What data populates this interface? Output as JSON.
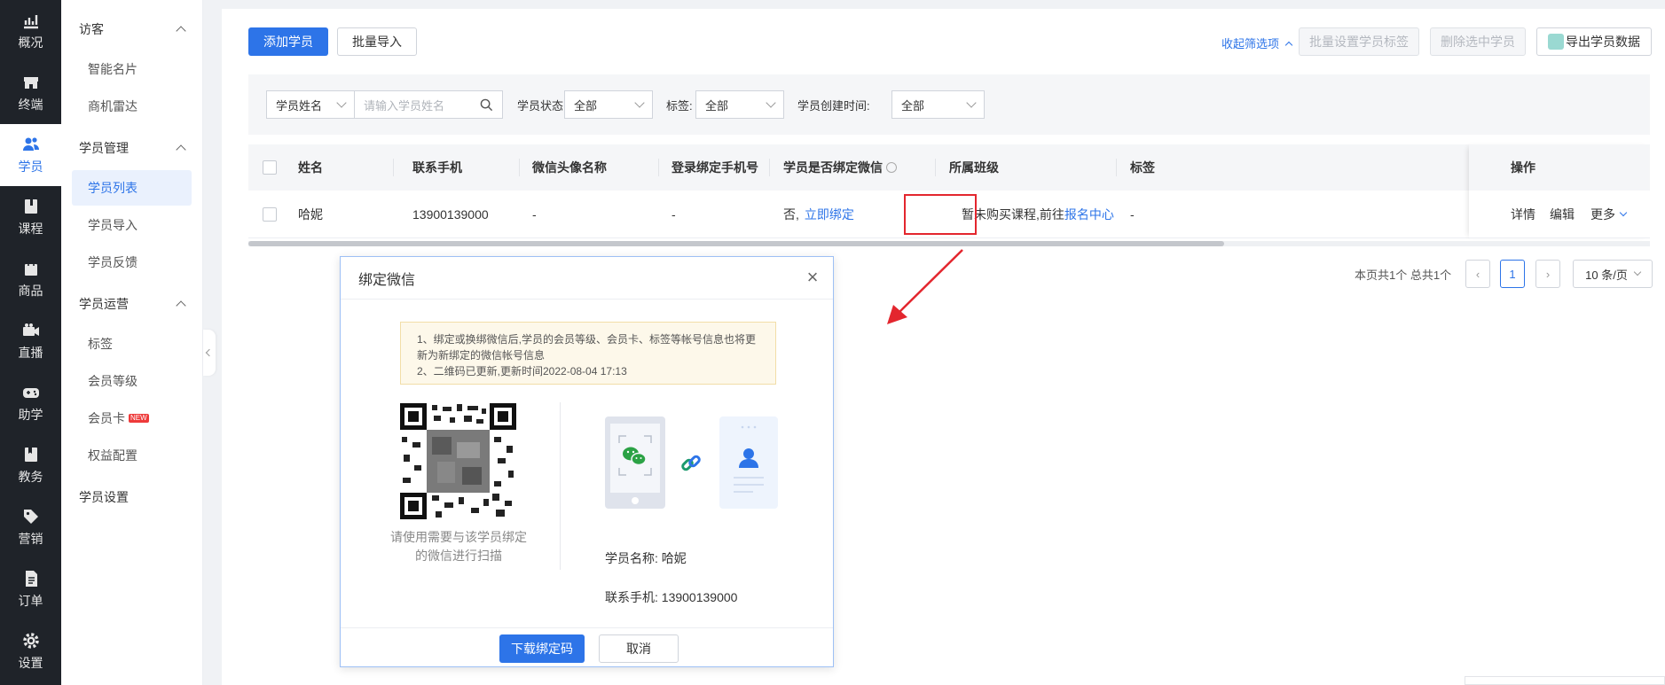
{
  "nav": {
    "items": [
      {
        "label": "概况",
        "icon": "chart-icon",
        "active": false
      },
      {
        "label": "终端",
        "icon": "store-icon",
        "active": false
      },
      {
        "label": "学员",
        "icon": "users-icon",
        "active": true
      },
      {
        "label": "课程",
        "icon": "book-icon",
        "active": false
      },
      {
        "label": "商品",
        "icon": "bag-icon",
        "active": false
      },
      {
        "label": "直播",
        "icon": "video-icon",
        "active": false
      },
      {
        "label": "助学",
        "icon": "gamepad-icon",
        "active": false
      },
      {
        "label": "教务",
        "icon": "notebook-icon",
        "active": false
      },
      {
        "label": "营销",
        "icon": "tag-icon",
        "active": false
      },
      {
        "label": "订单",
        "icon": "document-icon",
        "active": false
      },
      {
        "label": "设置",
        "icon": "gear-icon",
        "active": false
      }
    ]
  },
  "subnav": {
    "group_visitor": "访客",
    "visitor_items": [
      "智能名片",
      "商机雷达"
    ],
    "group_manage": "学员管理",
    "manage_items": [
      "学员列表",
      "学员导入",
      "学员反馈"
    ],
    "group_ops": "学员运营",
    "ops_items": [
      "标签",
      "会员等级",
      "会员卡",
      "权益配置"
    ],
    "new_badge": "NEW",
    "settings": "学员设置"
  },
  "toolbar": {
    "add_label": "添加学员",
    "import_label": "批量导入",
    "collapse_filters": "收起筛选项",
    "batch_tag_label": "批量设置学员标签",
    "delete_label": "删除选中学员",
    "export_label": "导出学员数据"
  },
  "filters": {
    "name_select": "学员姓名",
    "name_placeholder": "请输入学员姓名",
    "status_label": "学员状态:",
    "status_value": "全部",
    "tag_label": "标签:",
    "tag_value": "全部",
    "created_label": "学员创建时间:",
    "created_value": "全部"
  },
  "table": {
    "headers": [
      "姓名",
      "联系手机",
      "微信头像名称",
      "登录绑定手机号",
      "学员是否绑定微信",
      "所属班级",
      "标签",
      "操作"
    ],
    "row": {
      "name": "哈妮",
      "phone": "13900139000",
      "wechat_name": "-",
      "login_phone": "-",
      "bound_prefix": "否,",
      "bind_link": "立即绑定",
      "class_text": "暂未购买课程,前往",
      "class_link": "报名中心",
      "tag": "-",
      "ops": [
        "详情",
        "编辑",
        "更多"
      ]
    }
  },
  "pager": {
    "summary": "本页共1个 总共1个",
    "page": "1",
    "page_size": "10 条/页"
  },
  "modal": {
    "title": "绑定微信",
    "notice_1": "1、绑定或换绑微信后,学员的会员等级、会员卡、标签等帐号信息也将更新为新绑定的微信帐号信息",
    "notice_2": "2、二维码已更新,更新时间2022-08-04 17:13",
    "qr_tip": "请使用需要与该学员绑定的微信进行扫描",
    "student_name_label": "学员名称:",
    "student_name": "哈妮",
    "phone_label": "联系手机:",
    "phone": "13900139000",
    "download_label": "下载绑定码",
    "cancel_label": "取消"
  },
  "colors": {
    "primary": "#2d74e8",
    "highlight": "#e3262e",
    "wechat_green": "#2ba245"
  }
}
